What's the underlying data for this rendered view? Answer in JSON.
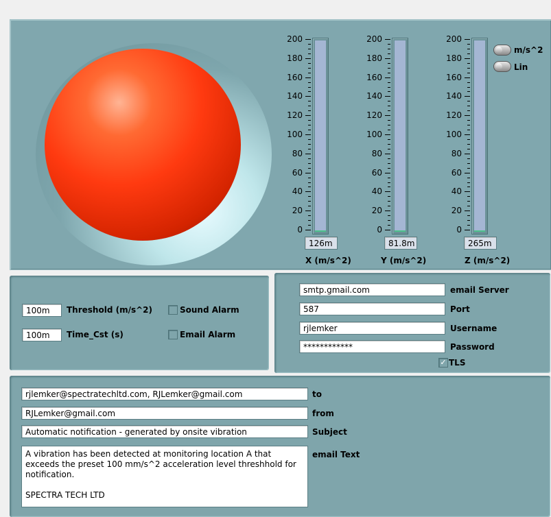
{
  "gauges": {
    "ticks": [
      "200",
      "180",
      "160",
      "140",
      "120",
      "100",
      "80",
      "60",
      "40",
      "20",
      "0"
    ],
    "x": {
      "value": "126m",
      "label": "X (m/s^2)",
      "level": 0.00063
    },
    "y": {
      "value": "81.8m",
      "label": "Y (m/s^2)",
      "level": 0.00041
    },
    "z": {
      "value": "265m",
      "label": "Z (m/s^2)",
      "level": 0.00133
    },
    "scale_max": 200
  },
  "alarm_lamp": {
    "state": "on",
    "color": "#ff3a10"
  },
  "units": {
    "unit_label": "m/s^2",
    "scale_label": "Lin"
  },
  "settings": {
    "threshold_value": "100m",
    "threshold_label": "Threshold (m/s^2)",
    "time_value": "100m",
    "time_label": "Time_Cst (s)",
    "sound_alarm_label": "Sound Alarm",
    "email_alarm_label": "Email Alarm"
  },
  "server": {
    "server_value": "smtp.gmail.com",
    "server_label": "email Server",
    "port_value": "587",
    "port_label": "Port",
    "username_value": "rjlemker",
    "username_label": "Username",
    "password_value": "************",
    "password_label": "Password",
    "tls_label": "TLS",
    "tls_checked": true
  },
  "message": {
    "to_value": "rjlemker@spectratechltd.com,  RJLemker@gmail.com",
    "to_label": "to",
    "from_value": "RJLemker@gmail.com",
    "from_label": "from",
    "subject_value": "Automatic notification - generated by onsite vibration",
    "subject_label": "Subject",
    "body_line1": "A vibration has been detected at monitoring location A that",
    "body_line2": "exceeds the preset 100 mm/s^2 acceleration level threshhold for",
    "body_line3": "notification.",
    "body_line4": "SPECTRA TECH LTD",
    "body_label": "email Text"
  }
}
